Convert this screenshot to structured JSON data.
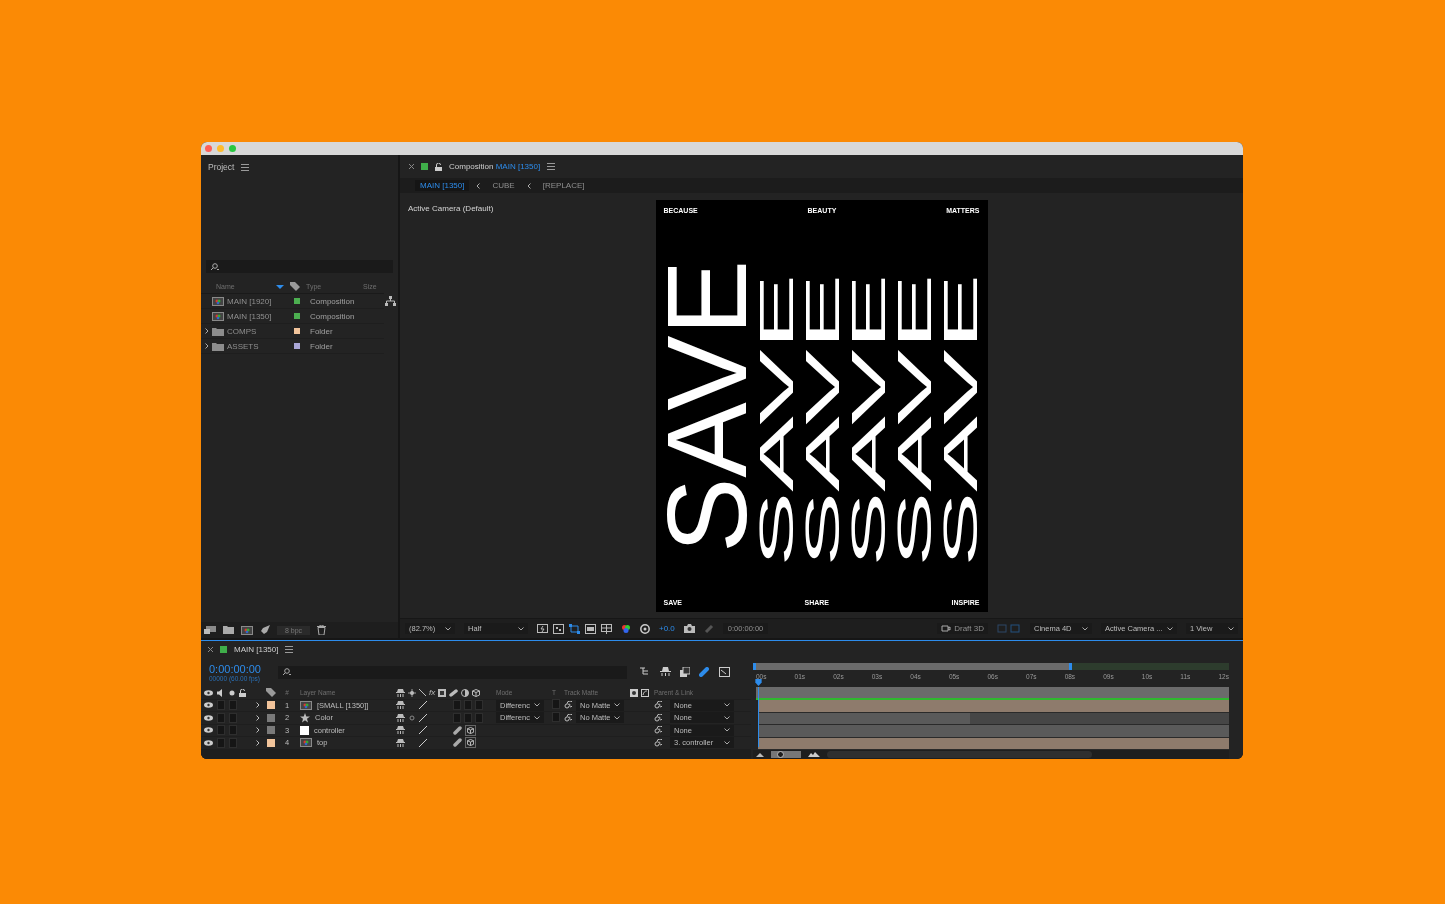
{
  "project": {
    "title": "Project",
    "columns": {
      "name": "Name",
      "type": "Type",
      "size": "Size"
    },
    "items": [
      {
        "name": "MAIN [1920]",
        "kind": "composition",
        "type": "Composition",
        "color": "#4caf50"
      },
      {
        "name": "MAIN [1350]",
        "kind": "composition",
        "type": "Composition",
        "color": "#4caf50"
      },
      {
        "name": "COMPS",
        "kind": "folder",
        "type": "Folder",
        "color": "#f2c49b"
      },
      {
        "name": "ASSETS",
        "kind": "folder",
        "type": "Folder",
        "color": "#a9a6d6"
      }
    ],
    "bit_depth": "8 bpc"
  },
  "composition": {
    "tab_label": "Composition",
    "tab_comp": "MAIN [1350]",
    "breadcrumbs": [
      {
        "label": "MAIN [1350]",
        "selected": true
      },
      {
        "label": "CUBE",
        "selected": false
      },
      {
        "label": "[REPLACE]",
        "selected": false
      }
    ],
    "camera_label": "Active Camera (Default)",
    "poster": {
      "top": [
        "BECAUSE",
        "BEAUTY",
        "MATTERS"
      ],
      "headline": "SAVE",
      "echoes": [
        "SAVE",
        "SAVE",
        "SAVE",
        "SAVE",
        "SAVE"
      ],
      "bottom": [
        "SAVE",
        "SHARE",
        "INSPIRE"
      ]
    },
    "toolbar": {
      "zoom": "(82.7%)",
      "resolution": "Half",
      "exposure": "+0.0",
      "timecode": "0:00:00:00",
      "draft_3d": "Draft 3D",
      "renderer": "Cinema 4D",
      "camera": "Active Camera ...",
      "views": "1 View"
    }
  },
  "timeline": {
    "tab": "MAIN [1350]",
    "timecode": "0:00:00:00",
    "frame_info": "00000 (60.00 fps)",
    "columns": {
      "number": "#",
      "layer_name": "Layer Name",
      "fx": "fx",
      "mode": "Mode",
      "t": "T",
      "track_matte": "Track Matte",
      "parent": "Parent & Link"
    },
    "work_area": {
      "level": 0.67
    },
    "zoom_slider": {
      "level": 0.3
    },
    "ruler": [
      "00s",
      "01s",
      "02s",
      "03s",
      "04s",
      "05s",
      "06s",
      "07s",
      "08s",
      "09s",
      "10s",
      "11s",
      "12s"
    ],
    "layers": [
      {
        "number": "1",
        "name": "[SMALL [1350]]",
        "kind": "footage",
        "color": "#f2c49b",
        "three_d": false,
        "mode": "Differenc",
        "track_matte": "No Matte",
        "parent": "None",
        "level": 1
      },
      {
        "number": "2",
        "name": "Color",
        "kind": "shape",
        "color": "#7a7a7a",
        "three_d": false,
        "mode": "Differenc",
        "track_matte": "No Matte",
        "parent": "None",
        "level": 0.45
      },
      {
        "number": "3",
        "name": "controller",
        "kind": "solid",
        "color": "#7a7a7a",
        "three_d": true,
        "parent": "None",
        "level": 1
      },
      {
        "number": "4",
        "name": "top",
        "kind": "footage",
        "color": "#f2c49b",
        "three_d": true,
        "parent": "3. controller",
        "level": 1
      }
    ]
  }
}
